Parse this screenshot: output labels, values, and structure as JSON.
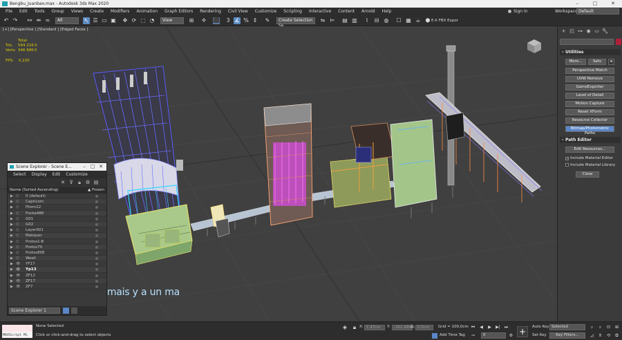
{
  "window": {
    "title": "Bengbu_Juanbao.max - Autodesk 3ds Max 2020"
  },
  "menu": [
    "File",
    "Edit",
    "Tools",
    "Group",
    "Views",
    "Create",
    "Modifiers",
    "Animation",
    "Graph Editors",
    "Rendering",
    "Civil View",
    "Customize",
    "Scripting",
    "Interactive",
    "Content",
    "Arnold",
    "Help"
  ],
  "header": {
    "sign_in": "Sign In",
    "workspaces_label": "Workspaces:",
    "workspace_value": "Default"
  },
  "toolbar": {
    "filter_value": "All",
    "refcoord_value": "View",
    "selection_set_placeholder": "Create Selection Se",
    "fbx_label": "E-X FBX Expor"
  },
  "viewport": {
    "label": "[+] [Perspective ] [Standard ] [Edged Faces ]",
    "stats_total_label": "Total",
    "stats": [
      {
        "key": "Tris",
        "v1": "594 216",
        "v2": "0"
      },
      {
        "key": "Verts",
        "v2": "0",
        "v1": "346 686"
      }
    ],
    "fps_label": "FPS:",
    "fps_value": "0,220"
  },
  "subtitle": "t la plus belle vue mais y a un ma",
  "scene_explorer": {
    "title": "Scene Explorer - Scene E...",
    "menu": [
      "Select",
      "Display",
      "Edit",
      "Customize"
    ],
    "col_name": "Name (Sorted Ascending)",
    "col_frozen": "▲ Frozen",
    "rows": [
      "0 (default)",
      "Capricorn",
      "Fitem22",
      "Focka486",
      "G01",
      "G02",
      "Layer001",
      "Makquer",
      "Protos1-B",
      "Protos70",
      "Protos80E",
      "Weeli",
      "YF17",
      "Yp13",
      "ZF12",
      "ZF17",
      "ZF7"
    ],
    "bold_row": "Yp13",
    "footer_select": "Scene Explorer 1"
  },
  "command_panel": {
    "utilities_title": "Utilities",
    "more_button": "More...",
    "sets_button": "Sets",
    "buttons": [
      "Perspective Match",
      "UVW Remove",
      "GameExporter",
      "Level of Detail",
      "Motion Capture",
      "Reset XForm",
      "Resource Collector",
      "Bitmap/Photometric Paths"
    ],
    "highlight_button": "Bitmap/Photometric Paths",
    "path_editor_title": "Path Editor",
    "edit_resources_button": "Edit Resources...",
    "include_material_editor": "Include Material Editor",
    "include_material_library": "Include Material Library",
    "close_button": "Close"
  },
  "status": {
    "maxscript_label": "MAXScript Mi",
    "selection": "None Selected",
    "prompt": "Click or click-and-drag to select objects",
    "x_label": "X:",
    "y_label": "Y:",
    "z_label": "Z:",
    "x_value": "1,47cm",
    "y_value": "-261,489m",
    "z_value": "0,0cm",
    "grid": "Grid = 100,0cm",
    "add_time_tag": "Add Time Tag",
    "auto_key": "Auto Key",
    "set_key": "Set Key",
    "selected_value": "Selected",
    "key_filters": "Key Filters...",
    "frame_value": "0"
  },
  "colors": {
    "accent": "#5b86c7",
    "viewport_bg": "#404040",
    "stats_yellow": "#e0d000"
  }
}
